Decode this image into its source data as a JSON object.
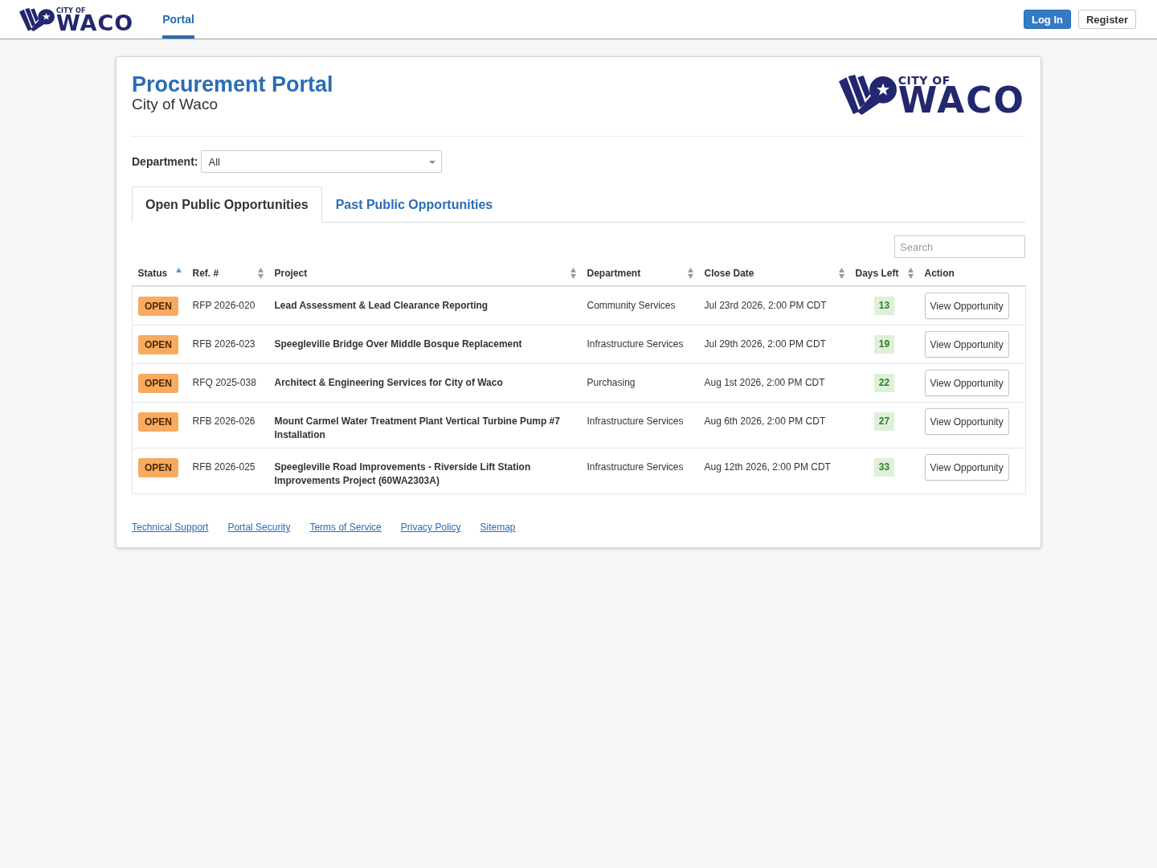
{
  "header": {
    "logo": {
      "line_1": "CITY OF",
      "line_2": "WACO"
    },
    "nav": [
      {
        "label": "Portal",
        "selected": true
      }
    ],
    "buttons": [
      {
        "label": "Log In",
        "kind": "primary"
      },
      {
        "label": "Register",
        "kind": "default"
      }
    ]
  },
  "portal": {
    "title": "Procurement Portal",
    "subtitle": "City of Waco",
    "logo": {
      "line_1": "CITY OF",
      "line_2": "WACO"
    },
    "department_filter": {
      "label": "Department:",
      "value": "All"
    },
    "tabs": [
      {
        "label": "Open Public Opportunities",
        "selected": true
      },
      {
        "label": "Past Public Opportunities",
        "selected": false
      }
    ],
    "search": {
      "placeholder": "Search"
    },
    "table": {
      "columns": [
        {
          "label": "Status",
          "sortable": true,
          "sorted": true
        },
        {
          "label": "Ref. #",
          "sortable": true,
          "sorted": false
        },
        {
          "label": "Project",
          "sortable": true,
          "sorted": false
        },
        {
          "label": "Department",
          "sortable": true,
          "sorted": false
        },
        {
          "label": "Close Date",
          "sortable": true,
          "sorted": false
        },
        {
          "label": "Days Left",
          "sortable": true,
          "sorted": false
        },
        {
          "label": "Action",
          "sortable": false
        }
      ],
      "rows": [
        {
          "status": "OPEN",
          "ref": "RFP 2026-020",
          "project": "Lead Assessment & Lead Clearance Reporting",
          "department": "Community Services",
          "close_date": "Jul 23rd 2026, 2:00 PM CDT",
          "days_left": "13",
          "action": "View Opportunity"
        },
        {
          "status": "OPEN",
          "ref": "RFB 2026-023",
          "project": "Speegleville Bridge Over Middle Bosque Replacement",
          "department": "Infrastructure Services",
          "close_date": "Jul 29th 2026, 2:00 PM CDT",
          "days_left": "19",
          "action": "View Opportunity"
        },
        {
          "status": "OPEN",
          "ref": "RFQ 2025-038",
          "project": "Architect & Engineering Services for City of Waco",
          "department": "Purchasing",
          "close_date": "Aug 1st 2026, 2:00 PM CDT",
          "days_left": "22",
          "action": "View Opportunity"
        },
        {
          "status": "OPEN",
          "ref": "RFB 2026-026",
          "project": "Mount Carmel Water Treatment Plant Vertical Turbine Pump #7 Installation",
          "department": "Infrastructure Services",
          "close_date": "Aug 6th 2026, 2:00 PM CDT",
          "days_left": "27",
          "action": "View Opportunity"
        },
        {
          "status": "OPEN",
          "ref": "RFB 2026-025",
          "project": "Speegleville Road Improvements - Riverside Lift Station Improvements Project (60WA2303A)",
          "department": "Infrastructure Services",
          "close_date": "Aug 12th 2026, 2:00 PM CDT",
          "days_left": "33",
          "action": "View Opportunity"
        }
      ]
    },
    "footer_links": [
      "Technical Support",
      "Portal Security",
      "Terms of Service",
      "Privacy Policy",
      "Sitemap"
    ]
  }
}
